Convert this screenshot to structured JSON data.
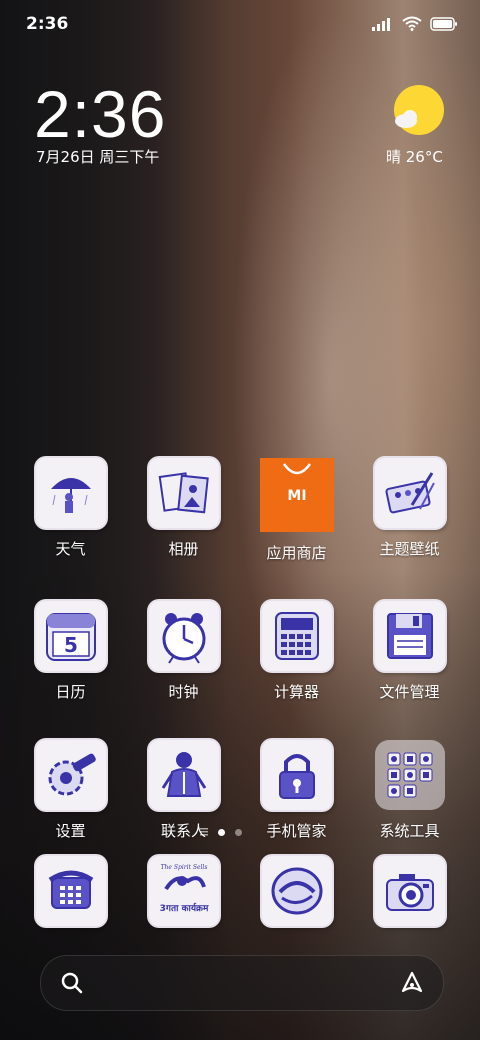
{
  "status_bar": {
    "time": "2:36"
  },
  "clock": {
    "time": "2:36",
    "date": "7月26日 周三下午"
  },
  "weather": {
    "text": "晴 26°C",
    "icon": "sun-cloud-icon"
  },
  "rows": [
    [
      {
        "label": "天气",
        "icon": "weather-app-icon"
      },
      {
        "label": "相册",
        "icon": "gallery-app-icon"
      },
      {
        "label": "应用商店",
        "icon": "mi-store-icon"
      },
      {
        "label": "主题壁纸",
        "icon": "themes-app-icon"
      }
    ],
    [
      {
        "label": "日历",
        "icon": "calendar-app-icon"
      },
      {
        "label": "时钟",
        "icon": "clock-app-icon"
      },
      {
        "label": "计算器",
        "icon": "calculator-app-icon"
      },
      {
        "label": "文件管理",
        "icon": "file-manager-icon"
      }
    ],
    [
      {
        "label": "设置",
        "icon": "settings-app-icon"
      },
      {
        "label": "联系人",
        "icon": "contacts-app-icon"
      },
      {
        "label": "手机管家",
        "icon": "security-app-icon"
      },
      {
        "label": "系统工具",
        "icon": "system-tools-folder-icon"
      }
    ]
  ],
  "calendar_day": "5",
  "store_logo": "MI",
  "dock": [
    {
      "icon": "phone-app-icon"
    },
    {
      "icon": "messages-app-icon",
      "caption_top": "The Spirit Sells",
      "caption_bottom": "3गता कार्यक्रम"
    },
    {
      "icon": "browser-app-icon"
    },
    {
      "icon": "camera-app-icon"
    }
  ],
  "page_indicator": {
    "pages": 2,
    "current": 1
  },
  "accent_colors": {
    "store": "#ef6c15",
    "sketch_ink": "#3a33a8",
    "sun": "#fdd835"
  }
}
